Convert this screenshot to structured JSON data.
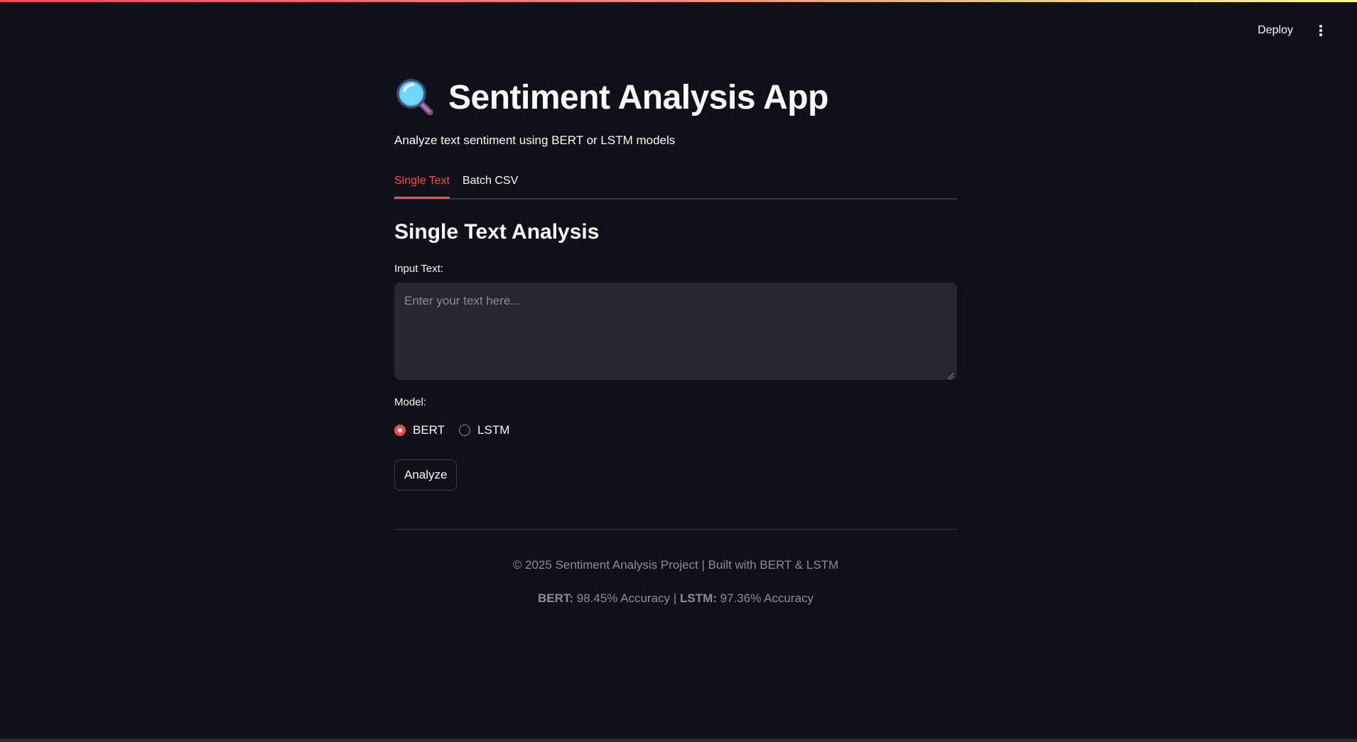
{
  "toolbar": {
    "deploy_label": "Deploy",
    "menu_icon": "more-vertical-icon"
  },
  "header": {
    "title_icon": "magnifying-glass-icon",
    "title": "Sentiment Analysis App",
    "subtitle": "Analyze text sentiment using BERT or LSTM models"
  },
  "tabs": [
    {
      "label": "Single Text",
      "active": true
    },
    {
      "label": "Batch CSV",
      "active": false
    }
  ],
  "single_text": {
    "section_title": "Single Text Analysis",
    "input_label": "Input Text:",
    "input_placeholder": "Enter your text here...",
    "input_value": "",
    "model_label": "Model:",
    "model_options": [
      {
        "label": "BERT",
        "selected": true
      },
      {
        "label": "LSTM",
        "selected": false
      }
    ],
    "analyze_label": "Analyze"
  },
  "footer": {
    "copyright": "© 2025 Sentiment Analysis Project | Built with BERT & LSTM",
    "bert_label": "BERT:",
    "bert_accuracy": "98.45% Accuracy",
    "separator": "|",
    "lstm_label": "LSTM:",
    "lstm_accuracy": "97.36% Accuracy"
  },
  "colors": {
    "background": "#0e1117",
    "accent": "#ff4b4b",
    "input_background": "#262730",
    "muted_text": "#8b8d97"
  }
}
